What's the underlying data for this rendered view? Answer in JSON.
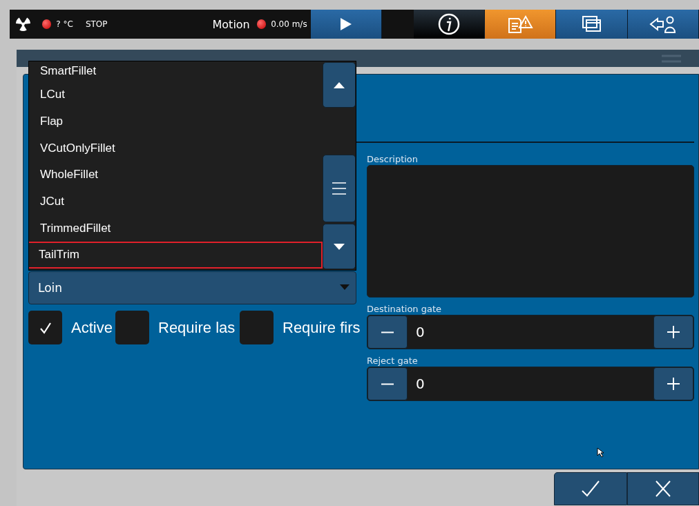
{
  "status_bar": {
    "temperature": "? °C",
    "state": "STOP",
    "motion_label": "Motion",
    "speed": "0.00 m/s"
  },
  "nav_buttons": [
    {
      "kind": "play",
      "selected": false,
      "disabled": false
    },
    {
      "kind": "info",
      "selected": false,
      "disabled": true
    },
    {
      "kind": "alerts",
      "selected": true,
      "disabled": false
    },
    {
      "kind": "windows",
      "selected": false,
      "disabled": false
    },
    {
      "kind": "user",
      "selected": false,
      "disabled": false
    }
  ],
  "dropdown": {
    "items": [
      {
        "label": "SmartFillet",
        "selected": false
      },
      {
        "label": "LCut",
        "selected": false
      },
      {
        "label": "Flap",
        "selected": false
      },
      {
        "label": "VCutOnlyFillet",
        "selected": false
      },
      {
        "label": "WholeFillet",
        "selected": false
      },
      {
        "label": "JCut",
        "selected": false
      },
      {
        "label": "TrimmedFillet",
        "selected": false
      },
      {
        "label": "TailTrim",
        "selected": true
      }
    ]
  },
  "combo": {
    "value": "Loin"
  },
  "checkboxes": [
    {
      "label": "Active",
      "checked": true
    },
    {
      "label": "Require las",
      "checked": false
    },
    {
      "label": "Require firs",
      "checked": false
    }
  ],
  "description": {
    "label": "Description"
  },
  "spinners": [
    {
      "label": "Destination gate",
      "value": "0"
    },
    {
      "label": "Reject gate",
      "value": "0"
    }
  ],
  "footer_buttons": [
    {
      "kind": "ok"
    },
    {
      "kind": "cancel"
    }
  ]
}
